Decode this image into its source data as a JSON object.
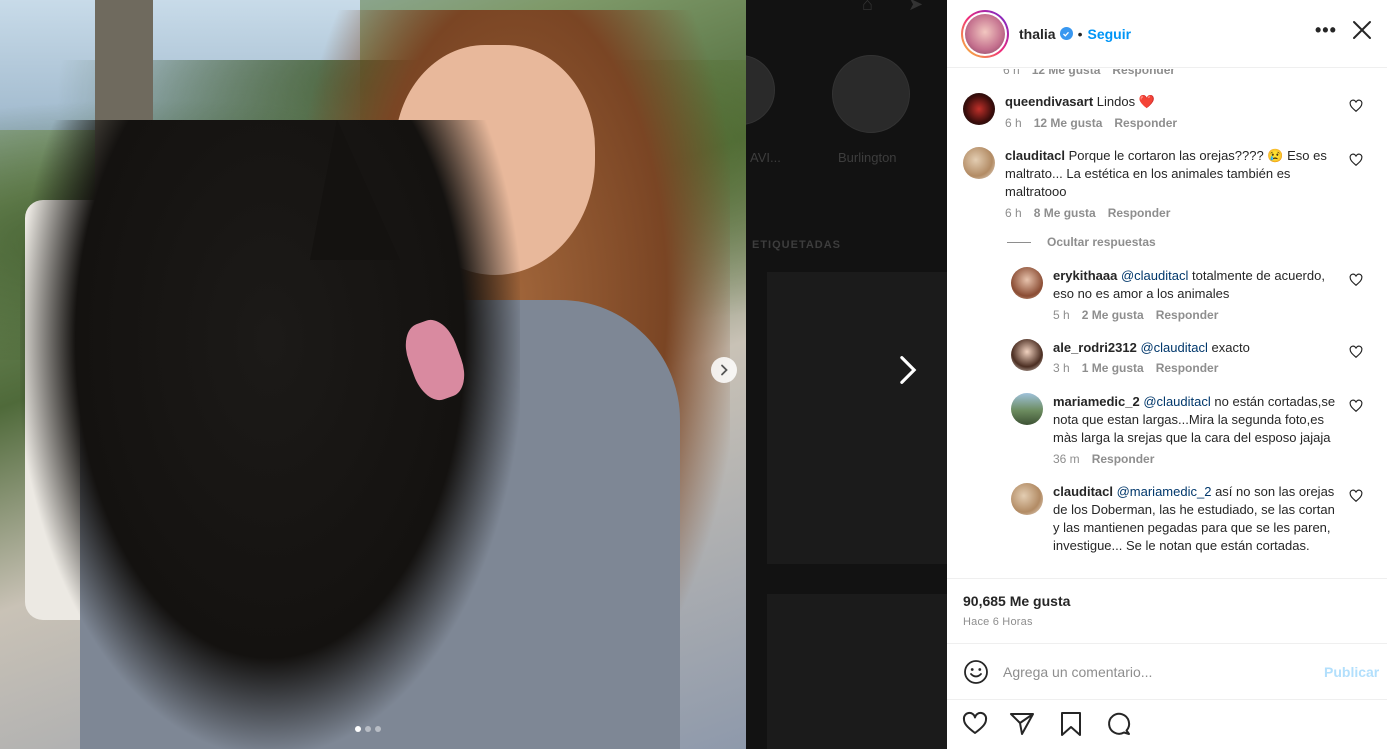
{
  "post": {
    "username": "thalia",
    "separator": "•",
    "follow_label": "Seguir",
    "more_label": "•••",
    "likes_count": "90,685",
    "likes_suffix": "Me gusta",
    "time_ago": "Hace 6 Horas"
  },
  "background": {
    "profile_labels": [
      "AVI...",
      "Burlington"
    ],
    "section_label": "ETIQUETADAS"
  },
  "comments": [
    {
      "user": "queendivasart",
      "text": "Lindos ❤️",
      "time": "6 h",
      "likes": "12 Me gusta",
      "reply": "Responder"
    },
    {
      "user": "clauditacl",
      "text": "Porque le cortaron las orejas???? 😢 Eso es maltrato... La estética en los animales también es maltratooo",
      "time": "6 h",
      "likes": "8 Me gusta",
      "reply": "Responder"
    }
  ],
  "partial_top_meta": {
    "time": "6 h",
    "likes": "12 Me gusta",
    "reply": "Responder"
  },
  "hide_replies_label": "Ocultar respuestas",
  "replies": [
    {
      "user": "erykithaaa",
      "mention": "@clauditacl",
      "text": "totalmente de acuerdo, eso no es amor a los animales",
      "time": "5 h",
      "likes": "2 Me gusta",
      "reply": "Responder"
    },
    {
      "user": "ale_rodri2312",
      "mention": "@clauditacl",
      "text": "exacto",
      "time": "3 h",
      "likes": "1 Me gusta",
      "reply": "Responder"
    },
    {
      "user": "mariamedic_2",
      "mention": "@clauditacl",
      "text": "no están cortadas,se nota que estan largas...Mira la segunda foto,es màs larga la srejas que la cara del esposo jajaja",
      "time": "36 m",
      "likes": "",
      "reply": "Responder"
    },
    {
      "user": "clauditacl",
      "mention": "@mariamedic_2",
      "text": "así no son las orejas de los Doberman, las he estudiado, se las cortan y las mantienen pegadas para que se les paren, investigue... Se le notan que están cortadas."
    }
  ],
  "composer": {
    "placeholder": "Agrega un comentario...",
    "publish_label": "Publicar"
  },
  "carousel": {
    "current": 1,
    "total": 3
  },
  "colors": {
    "link_blue": "#0095f6",
    "publish_disabled": "#b2dffc",
    "meta_gray": "#8e8e8e",
    "mention": "#00376b"
  },
  "icons": [
    "verified-badge-icon",
    "more-options-icon",
    "close-icon",
    "heart-icon",
    "emoji-icon",
    "like-icon",
    "share-icon",
    "save-icon",
    "comment-icon",
    "next-slide-icon"
  ]
}
